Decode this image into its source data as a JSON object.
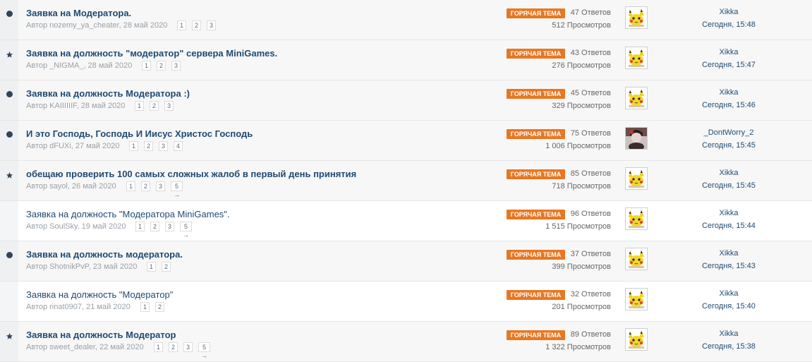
{
  "colors": {
    "link": "#1f4a73",
    "hot_badge": "#e87722",
    "meta_text": "#9aa0a6",
    "dot_marker": "#30455b"
  },
  "topics": [
    {
      "marker": "dot",
      "title": "Заявка на Модератора.",
      "title_bold": true,
      "meta": "Автор nozemy_ya_cheater, 28 май 2020",
      "pages": [
        "1",
        "2",
        "3"
      ],
      "badge": "ГОРЯЧАЯ ТЕМА",
      "replies": "47 Ответов",
      "views": "512 Просмотров",
      "avatar": "pikachu-avatar",
      "last_by": "Xikka",
      "last_date": "Сегодня, 15:48"
    },
    {
      "marker": "star",
      "title": "Заявка на должность \"модератор\" сервера MiniGames.",
      "title_bold": true,
      "meta": "Автор _NIGMA_, 28 май 2020",
      "pages": [
        "1",
        "2",
        "3"
      ],
      "badge": "ГОРЯЧАЯ ТЕМА",
      "replies": "43 Ответов",
      "views": "276 Просмотров",
      "avatar": "pikachu-avatar",
      "last_by": "Xikka",
      "last_date": "Сегодня, 15:47"
    },
    {
      "marker": "dot",
      "title": "Заявка на должность Модератора :)",
      "title_bold": true,
      "meta": "Автор KAIIIIIIF, 28 май 2020",
      "pages": [
        "1",
        "2",
        "3"
      ],
      "badge": "ГОРЯЧАЯ ТЕМА",
      "replies": "45 Ответов",
      "views": "329 Просмотров",
      "avatar": "pikachu-avatar",
      "last_by": "Xikka",
      "last_date": "Сегодня, 15:46"
    },
    {
      "marker": "dot",
      "title": "И это Господь, Господь И Иисус Христос Господь",
      "title_bold": true,
      "meta": "Автор dFUXi, 27 май 2020",
      "pages": [
        "1",
        "2",
        "3",
        "4"
      ],
      "badge": "ГОРЯЧАЯ ТЕМА",
      "replies": "75 Ответов",
      "views": "1 006 Просмотров",
      "avatar": "photo-avatar",
      "last_by": "_DontWorry_2",
      "last_date": "Сегодня, 15:45"
    },
    {
      "marker": "star",
      "title": "обещаю проверить 100 самых сложных жалоб в первый день принятия",
      "title_bold": true,
      "meta": "Автор sayol, 26 май 2020",
      "pages": [
        "1",
        "2",
        "3",
        "5 →"
      ],
      "badge": "ГОРЯЧАЯ ТЕМА",
      "replies": "85 Ответов",
      "views": "718 Просмотров",
      "avatar": "pikachu-avatar",
      "last_by": "Xikka",
      "last_date": "Сегодня, 15:45"
    },
    {
      "marker": "none",
      "title": "Заявка на должность \"Модератора MiniGames\".",
      "title_bold": false,
      "meta": "Автор SoulSky, 19 май 2020",
      "pages": [
        "1",
        "2",
        "3",
        "5 →"
      ],
      "badge": "ГОРЯЧАЯ ТЕМА",
      "replies": "96 Ответов",
      "views": "1 515 Просмотров",
      "avatar": "pikachu-avatar",
      "last_by": "Xikka",
      "last_date": "Сегодня, 15:44"
    },
    {
      "marker": "dot",
      "title": "Заявка на должность модератора.",
      "title_bold": true,
      "meta": "Автор ShotnikPvP, 23 май 2020",
      "pages": [
        "1",
        "2"
      ],
      "badge": "ГОРЯЧАЯ ТЕМА",
      "replies": "37 Ответов",
      "views": "399 Просмотров",
      "avatar": "pikachu-avatar",
      "last_by": "Xikka",
      "last_date": "Сегодня, 15:43"
    },
    {
      "marker": "none",
      "title": "Заявка на должность \"Модератор\"",
      "title_bold": false,
      "meta": "Автор rinat0907, 21 май 2020",
      "pages": [
        "1",
        "2"
      ],
      "badge": "ГОРЯЧАЯ ТЕМА",
      "replies": "32 Ответов",
      "views": "201 Просмотров",
      "avatar": "pikachu-avatar",
      "last_by": "Xikka",
      "last_date": "Сегодня, 15:40"
    },
    {
      "marker": "star",
      "title": "Заявка на должность Модератор",
      "title_bold": true,
      "meta": "Автор sweet_dealer, 22 май 2020",
      "pages": [
        "1",
        "2",
        "3",
        "5 →"
      ],
      "badge": "ГОРЯЧАЯ ТЕМА",
      "replies": "89 Ответов",
      "views": "1 322 Просмотров",
      "avatar": "pikachu-avatar",
      "last_by": "Xikka",
      "last_date": "Сегодня, 15:38"
    }
  ]
}
